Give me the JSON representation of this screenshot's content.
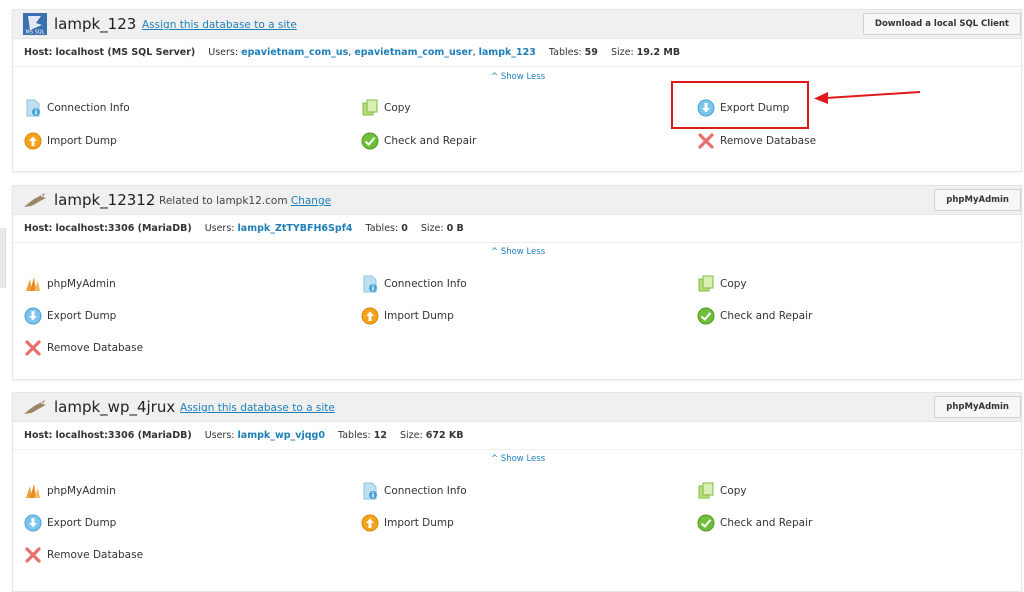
{
  "databases": [
    {
      "name": "lampk_123",
      "icon": "ms-sql-icon",
      "head_link": "Assign this database to a site",
      "head_button": "Download a local SQL Client",
      "host_label": "Host:",
      "host_value": "localhost (MS SQL Server)",
      "users_label": "Users:",
      "users": [
        "epavietnam_com_us",
        "epavietnam_com_user",
        "lampk_123"
      ],
      "tables_label": "Tables:",
      "tables_value": "59",
      "size_label": "Size:",
      "size_value": "19.2 MB",
      "show_less": "^ Show Less",
      "actions": [
        "Connection Info",
        "Copy",
        "Export Dump",
        "Import Dump",
        "Check and Repair",
        "Remove Database"
      ]
    },
    {
      "name": "lampk_12312",
      "icon": "mariadb-seal-icon",
      "head_related": "Related to lampk12.com",
      "head_related_link": "Change",
      "head_button": "phpMyAdmin",
      "host_label": "Host:",
      "host_value": "localhost:3306 (MariaDB)",
      "users_label": "Users:",
      "users": [
        "lampk_ZtTYBFH6Spf4"
      ],
      "tables_label": "Tables:",
      "tables_value": "0",
      "size_label": "Size:",
      "size_value": "0 B",
      "show_less": "^ Show Less",
      "actions": [
        "phpMyAdmin",
        "Connection Info",
        "Copy",
        "Export Dump",
        "Import Dump",
        "Check and Repair",
        "Remove Database"
      ]
    },
    {
      "name": "lampk_wp_4jrux",
      "icon": "mariadb-seal-icon",
      "head_link": "Assign this database to a site",
      "head_button": "phpMyAdmin",
      "host_label": "Host:",
      "host_value": "localhost:3306 (MariaDB)",
      "users_label": "Users:",
      "users": [
        "lampk_wp_vjqg0"
      ],
      "tables_label": "Tables:",
      "tables_value": "12",
      "size_label": "Size:",
      "size_value": "672 KB",
      "show_less": "^ Show Less",
      "actions": [
        "phpMyAdmin",
        "Connection Info",
        "Copy",
        "Export Dump",
        "Import Dump",
        "Check and Repair",
        "Remove Database"
      ]
    }
  ],
  "annotation": {
    "highlight_color": "#e0191b",
    "highlight_target": "Export Dump"
  },
  "colors": {
    "link": "#1e7fb8",
    "header_bg": "#f0f0f0"
  }
}
